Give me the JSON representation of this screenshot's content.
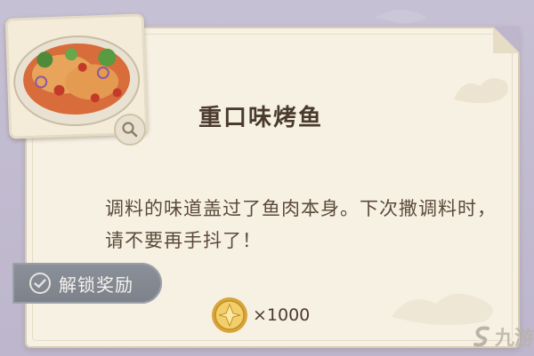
{
  "card": {
    "title": "重口味烤鱼",
    "description": "调料的味道盖过了鱼肉本身。下次撒调料时，请不要再手抖了！"
  },
  "unlock": {
    "label": "解锁奖励",
    "icon": "check-circle-icon"
  },
  "reward": {
    "icon": "gold-coin-icon",
    "count": "×1000"
  },
  "watermark": {
    "text": "九游",
    "icon": "jiuyou-logo-icon"
  },
  "colors": {
    "background": "#c6c0d4",
    "card": "#f7f1e4",
    "text": "#4a3b2e",
    "pill": "#8b9099",
    "coin": "#e0b544"
  }
}
